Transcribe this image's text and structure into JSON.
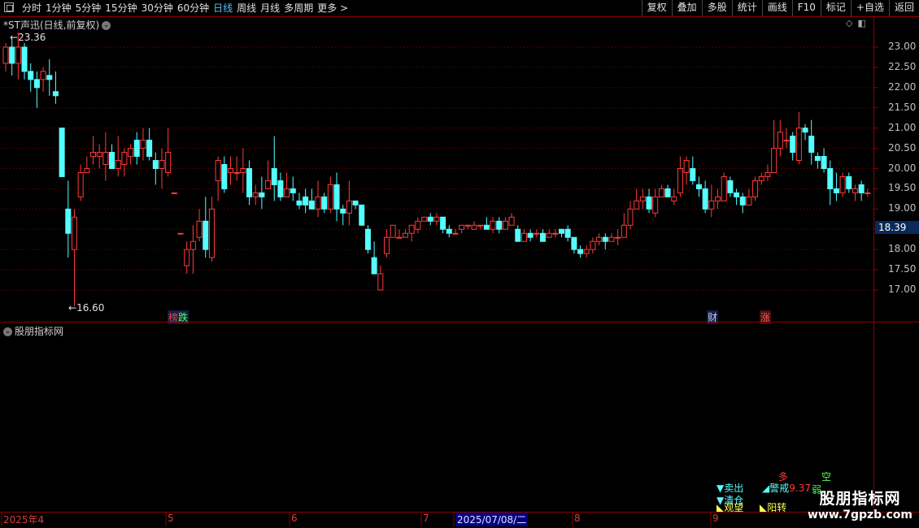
{
  "toolbar": {
    "tabs": [
      "分时",
      "1分钟",
      "5分钟",
      "15分钟",
      "30分钟",
      "60分钟",
      "日线",
      "周线",
      "月线",
      "多周期",
      "更多 >"
    ],
    "active_tab": "日线",
    "right_tools": [
      "复权",
      "叠加",
      "多股",
      "统计",
      "画线",
      "F10",
      "标记",
      "+自选",
      "返回"
    ]
  },
  "chart_title": "*ST声迅(日线,前复权)",
  "sub_title": "股朋指标网",
  "price_axis": [
    "23.00",
    "22.50",
    "22.00",
    "21.50",
    "21.00",
    "20.50",
    "20.00",
    "19.50",
    "19.00",
    "18.50",
    "18.00",
    "17.50",
    "17.00"
  ],
  "current_price": "18.39",
  "high_marker": "23.36",
  "low_marker": "16.60",
  "date_labels": [
    "2025年4",
    "5",
    "6",
    "7",
    "2025/07/08/二",
    "8",
    "9"
  ],
  "markers": {
    "bang": "榜",
    "die": "跌",
    "cai": "财",
    "zhang": "涨"
  },
  "signals": {
    "sell": "▼卖出",
    "warn": "警戒",
    "warn_val": "9.37",
    "duo": "多",
    "kong": "空",
    "qingcang": "▼清仓",
    "kanwang": "观望",
    "yangzhuan": "阳转",
    "ruo": "弱"
  },
  "watermark": {
    "line1": "股朋指标网",
    "line2": "www.7gpzb.com"
  },
  "colors": {
    "up": "#ff3a3a",
    "down": "#54ffff",
    "grid": "#8b0000",
    "bg": "#000000"
  },
  "chart_data": {
    "type": "candlestick",
    "ylim": [
      16.6,
      23.4
    ],
    "candles": [
      [
        22.6,
        23.0,
        23.1,
        22.4
      ],
      [
        23.0,
        22.6,
        23.2,
        22.3
      ],
      [
        22.6,
        23.0,
        23.36,
        22.2
      ],
      [
        23.0,
        22.4,
        23.1,
        22.2
      ],
      [
        22.4,
        22.2,
        22.6,
        21.9
      ],
      [
        22.2,
        22.0,
        22.4,
        21.5
      ],
      [
        22.2,
        22.4,
        22.5,
        21.9
      ],
      [
        22.3,
        22.2,
        22.7,
        21.8
      ],
      [
        21.9,
        21.8,
        22.4,
        21.6
      ],
      [
        21.0,
        19.8,
        21.0,
        19.8
      ],
      [
        19.0,
        18.4,
        19.7,
        17.8
      ],
      [
        18.0,
        18.8,
        19.0,
        16.6
      ],
      [
        19.3,
        19.9,
        20.1,
        19.2
      ],
      [
        19.9,
        20.0,
        20.3,
        19.9
      ],
      [
        20.3,
        20.4,
        20.8,
        20.1
      ],
      [
        20.3,
        20.4,
        20.6,
        20.0
      ],
      [
        20.1,
        20.4,
        20.9,
        19.7
      ],
      [
        20.4,
        20.0,
        20.6,
        20.0
      ],
      [
        20.0,
        20.2,
        20.8,
        19.8
      ],
      [
        20.1,
        20.4,
        20.5,
        19.8
      ],
      [
        20.3,
        20.5,
        20.6,
        20.1
      ],
      [
        20.7,
        20.3,
        20.9,
        20.1
      ],
      [
        20.5,
        20.7,
        21.0,
        20.2
      ],
      [
        20.7,
        20.3,
        21.0,
        20.2
      ],
      [
        20.2,
        20.0,
        20.4,
        19.6
      ],
      [
        20.0,
        20.2,
        20.5,
        19.5
      ],
      [
        19.9,
        20.4,
        21.0,
        19.8
      ],
      [
        19.4,
        19.4,
        19.4,
        19.4
      ],
      [
        18.4,
        18.4,
        18.4,
        18.4
      ],
      [
        17.6,
        18.0,
        18.2,
        17.4
      ],
      [
        18.0,
        18.2,
        18.6,
        17.4
      ],
      [
        18.3,
        18.7,
        19.0,
        18.2
      ],
      [
        18.7,
        18.0,
        19.3,
        17.8
      ],
      [
        17.8,
        19.0,
        19.3,
        17.7
      ],
      [
        19.7,
        20.2,
        20.3,
        19.2
      ],
      [
        20.1,
        19.5,
        20.3,
        19.4
      ],
      [
        19.9,
        20.0,
        20.3,
        19.6
      ],
      [
        19.9,
        19.9,
        20.3,
        19.7
      ],
      [
        19.9,
        20.0,
        20.5,
        19.4
      ],
      [
        20.0,
        19.3,
        20.2,
        19.1
      ],
      [
        19.3,
        19.4,
        19.6,
        19.1
      ],
      [
        19.4,
        19.3,
        19.8,
        19.0
      ],
      [
        19.5,
        19.7,
        20.2,
        19.5
      ],
      [
        20.0,
        19.6,
        20.8,
        19.2
      ],
      [
        19.7,
        19.3,
        19.9,
        19.2
      ],
      [
        19.3,
        19.5,
        19.9,
        19.3
      ],
      [
        19.5,
        19.4,
        19.8,
        19.2
      ],
      [
        19.2,
        19.1,
        19.4,
        19.0
      ],
      [
        19.3,
        19.1,
        19.5,
        18.9
      ],
      [
        19.2,
        19.0,
        19.5,
        19.0
      ],
      [
        19.0,
        19.3,
        19.7,
        18.8
      ],
      [
        19.3,
        19.0,
        19.4,
        18.9
      ],
      [
        19.0,
        19.6,
        19.8,
        18.9
      ],
      [
        19.6,
        19.0,
        19.9,
        18.7
      ],
      [
        19.0,
        18.9,
        19.1,
        18.6
      ],
      [
        18.9,
        19.2,
        19.7,
        18.6
      ],
      [
        19.2,
        19.1,
        19.2,
        19.0
      ],
      [
        19.1,
        18.6,
        19.1,
        18.6
      ],
      [
        18.5,
        18.0,
        18.6,
        17.9
      ],
      [
        17.8,
        17.4,
        18.2,
        17.4
      ],
      [
        17.0,
        17.4,
        17.6,
        17.0
      ],
      [
        17.9,
        18.3,
        18.5,
        17.8
      ],
      [
        18.3,
        18.6,
        18.6,
        18.3
      ],
      [
        18.3,
        18.3,
        18.5,
        18.3
      ],
      [
        18.3,
        18.4,
        18.5,
        18.3
      ],
      [
        18.4,
        18.6,
        18.6,
        18.2
      ],
      [
        18.5,
        18.7,
        18.8,
        18.4
      ],
      [
        18.7,
        18.8,
        18.8,
        18.7
      ],
      [
        18.8,
        18.7,
        18.9,
        18.6
      ],
      [
        18.7,
        18.8,
        18.9,
        18.6
      ],
      [
        18.8,
        18.5,
        18.8,
        18.4
      ],
      [
        18.5,
        18.4,
        18.6,
        18.3
      ],
      [
        18.4,
        18.4,
        18.5,
        18.4
      ],
      [
        18.5,
        18.6,
        18.6,
        18.4
      ],
      [
        18.6,
        18.6,
        18.6,
        18.5
      ],
      [
        18.5,
        18.6,
        18.7,
        18.5
      ],
      [
        18.6,
        18.6,
        18.6,
        18.5
      ],
      [
        18.6,
        18.5,
        18.8,
        18.5
      ],
      [
        18.5,
        18.7,
        18.8,
        18.4
      ],
      [
        18.7,
        18.5,
        18.8,
        18.4
      ],
      [
        18.5,
        18.7,
        18.8,
        18.5
      ],
      [
        18.6,
        18.8,
        18.9,
        18.6
      ],
      [
        18.5,
        18.2,
        18.6,
        18.2
      ],
      [
        18.2,
        18.4,
        18.5,
        18.2
      ],
      [
        18.4,
        18.3,
        18.5,
        18.2
      ],
      [
        18.4,
        18.4,
        18.5,
        18.3
      ],
      [
        18.4,
        18.2,
        18.5,
        18.2
      ],
      [
        18.3,
        18.4,
        18.5,
        18.3
      ],
      [
        18.4,
        18.4,
        18.5,
        18.3
      ],
      [
        18.5,
        18.4,
        18.5,
        18.3
      ],
      [
        18.5,
        18.3,
        18.6,
        18.2
      ],
      [
        18.3,
        18.0,
        18.3,
        17.9
      ],
      [
        18.0,
        17.9,
        18.1,
        17.8
      ],
      [
        17.9,
        18.0,
        18.1,
        17.8
      ],
      [
        18.0,
        18.2,
        18.3,
        17.9
      ],
      [
        18.2,
        18.3,
        18.4,
        18.1
      ],
      [
        18.3,
        18.2,
        18.4,
        18.0
      ],
      [
        18.2,
        18.3,
        18.4,
        18.2
      ],
      [
        18.3,
        18.3,
        18.5,
        18.1
      ],
      [
        18.3,
        18.6,
        18.9,
        18.3
      ],
      [
        18.6,
        19.0,
        19.2,
        18.5
      ],
      [
        19.0,
        19.2,
        19.5,
        19.0
      ],
      [
        19.2,
        19.3,
        19.5,
        19.0
      ],
      [
        19.3,
        19.0,
        19.5,
        18.9
      ],
      [
        18.9,
        19.3,
        19.5,
        18.8
      ],
      [
        19.3,
        19.5,
        19.6,
        19.3
      ],
      [
        19.5,
        19.3,
        19.6,
        19.3
      ],
      [
        19.2,
        19.3,
        19.5,
        19.1
      ],
      [
        19.4,
        20.0,
        20.3,
        19.3
      ],
      [
        19.9,
        20.2,
        20.3,
        19.6
      ],
      [
        20.0,
        19.7,
        20.3,
        19.6
      ],
      [
        19.6,
        19.5,
        19.8,
        19.3
      ],
      [
        19.5,
        19.0,
        19.7,
        18.9
      ],
      [
        19.0,
        19.2,
        19.6,
        18.8
      ],
      [
        19.2,
        19.3,
        19.5,
        19.0
      ],
      [
        19.2,
        19.8,
        19.9,
        19.2
      ],
      [
        19.7,
        19.4,
        19.8,
        19.3
      ],
      [
        19.4,
        19.3,
        19.5,
        19.1
      ],
      [
        19.3,
        19.1,
        19.4,
        18.9
      ],
      [
        19.1,
        19.3,
        19.5,
        19.1
      ],
      [
        19.3,
        19.7,
        19.8,
        19.2
      ],
      [
        19.7,
        19.8,
        19.9,
        19.6
      ],
      [
        19.8,
        19.9,
        20.1,
        19.7
      ],
      [
        19.9,
        20.5,
        21.2,
        19.9
      ],
      [
        20.5,
        20.9,
        21.2,
        20.3
      ],
      [
        20.7,
        20.7,
        21.0,
        20.5
      ],
      [
        20.8,
        20.4,
        20.9,
        20.2
      ],
      [
        20.2,
        21.0,
        21.4,
        20.1
      ],
      [
        21.0,
        20.9,
        21.1,
        20.7
      ],
      [
        20.8,
        20.4,
        21.2,
        20.1
      ],
      [
        20.3,
        20.2,
        20.4,
        20.0
      ],
      [
        20.3,
        20.0,
        20.5,
        19.9
      ],
      [
        20.0,
        19.5,
        20.2,
        19.1
      ],
      [
        19.5,
        19.4,
        19.9,
        19.2
      ],
      [
        19.4,
        19.8,
        19.9,
        19.3
      ],
      [
        19.8,
        19.5,
        19.9,
        19.4
      ],
      [
        19.4,
        19.5,
        19.6,
        19.2
      ],
      [
        19.6,
        19.4,
        19.7,
        19.2
      ],
      [
        19.4,
        19.4,
        19.5,
        19.3
      ]
    ]
  }
}
